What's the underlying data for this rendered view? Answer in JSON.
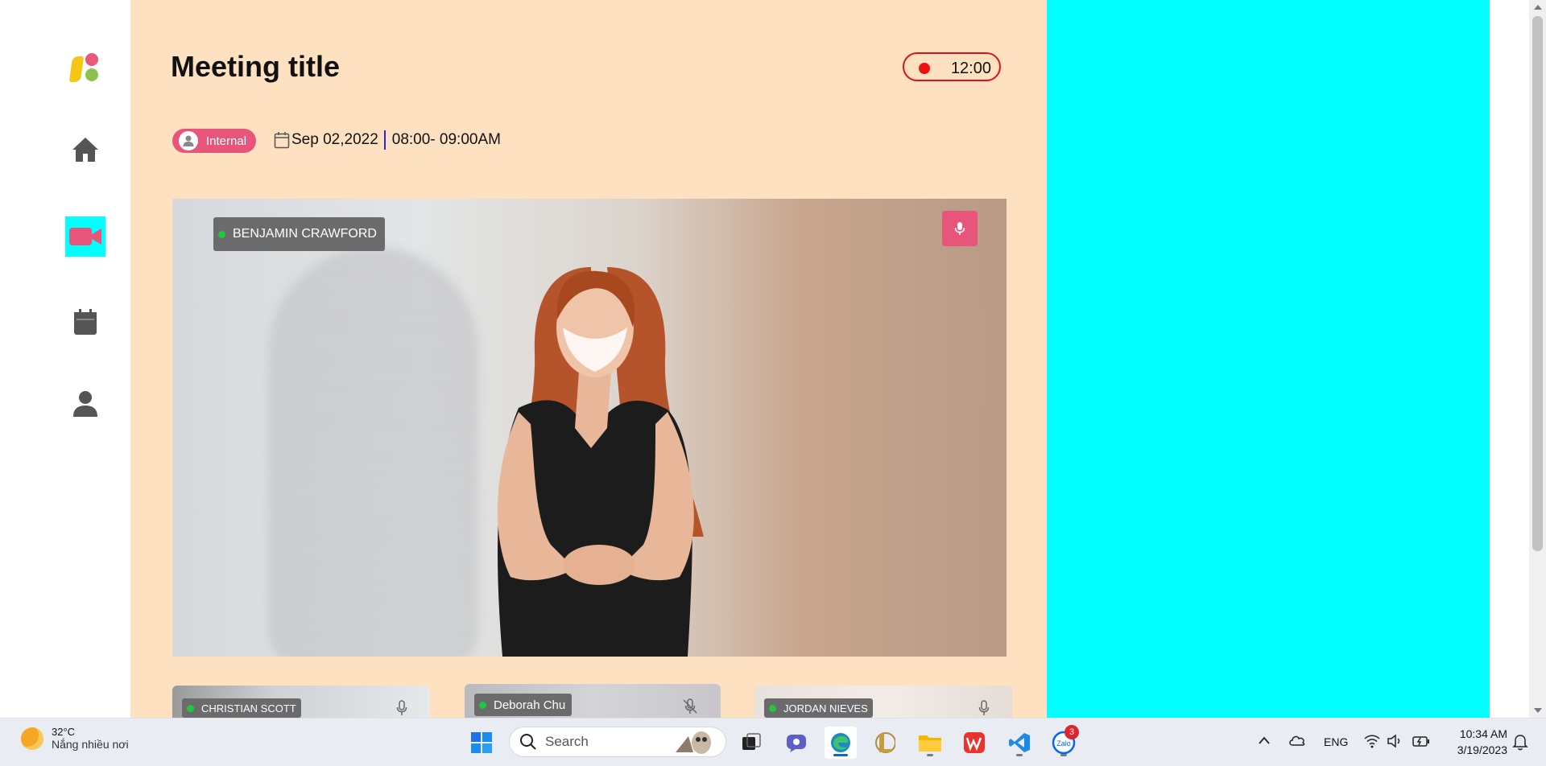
{
  "meeting": {
    "title": "Meeting title",
    "timer": "12:00",
    "tag": "Internal",
    "date": "Sep 02,2022",
    "time_range": "08:00-  09:00AM"
  },
  "main_speaker": {
    "name": "BENJAMIN CRAWFORD",
    "online": true,
    "mic": "on"
  },
  "participants": [
    {
      "name": "CHRISTIAN SCOTT",
      "mic": "on"
    },
    {
      "name": "Deborah Chu",
      "mic": "muted"
    },
    {
      "name": "JORDAN NIEVES",
      "mic": "on"
    }
  ],
  "sidebar": {
    "items": [
      {
        "name": "home-icon",
        "active": false
      },
      {
        "name": "video-camera-icon",
        "active": true
      },
      {
        "name": "calendar-icon",
        "active": false
      },
      {
        "name": "user-icon",
        "active": false
      }
    ]
  },
  "colors": {
    "accent": "#e8557a",
    "background": "#fde1c0",
    "panel": "#00ffff",
    "record": "#e0101a"
  },
  "taskbar": {
    "weather_temp": "32°C",
    "weather_desc": "Nắng nhiều nơi",
    "search_placeholder": "Search",
    "language": "ENG",
    "time": "10:34 AM",
    "date": "3/19/2023",
    "zalo_badge": "3",
    "zalo_label": "Zalo"
  }
}
